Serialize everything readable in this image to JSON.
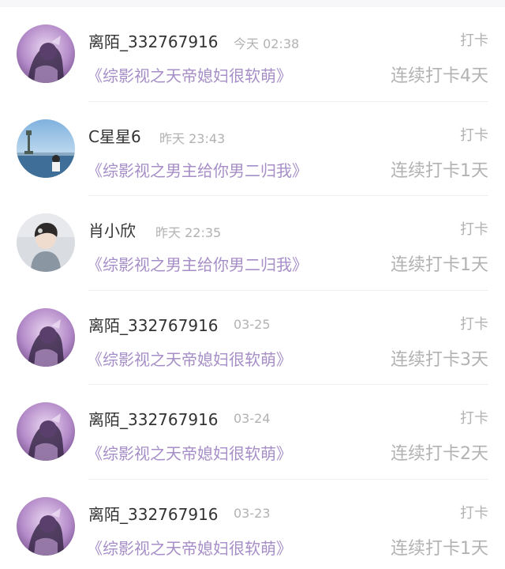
{
  "feed": {
    "items": [
      {
        "user": "离陌_332767916",
        "time": "今天 02:38",
        "book": "《综影视之天帝媳妇很软萌》",
        "tag": "打卡",
        "streak": "连续打卡4天",
        "avatar_icon": "purple-girl-avatar-icon"
      },
      {
        "user": "C星星6",
        "time": "昨天 23:43",
        "book": "《综影视之男主给你男二归我》",
        "tag": "打卡",
        "streak": "连续打卡1天",
        "avatar_icon": "statue-of-liberty-avatar-icon"
      },
      {
        "user": "肖小欣",
        "time": "昨天 22:35",
        "book": "《综影视之男主给你男二归我》",
        "tag": "打卡",
        "streak": "连续打卡1天",
        "avatar_icon": "boy-portrait-avatar-icon"
      },
      {
        "user": "离陌_332767916",
        "time": "03-25",
        "book": "《综影视之天帝媳妇很软萌》",
        "tag": "打卡",
        "streak": "连续打卡3天",
        "avatar_icon": "purple-girl-avatar-icon"
      },
      {
        "user": "离陌_332767916",
        "time": "03-24",
        "book": "《综影视之天帝媳妇很软萌》",
        "tag": "打卡",
        "streak": "连续打卡2天",
        "avatar_icon": "purple-girl-avatar-icon"
      },
      {
        "user": "离陌_332767916",
        "time": "03-23",
        "book": "《综影视之天帝媳妇很软萌》",
        "tag": "打卡",
        "streak": "连续打卡1天",
        "avatar_icon": "purple-girl-avatar-icon"
      }
    ]
  },
  "colors": {
    "book_title": "#a68ec7",
    "username": "#333333",
    "meta_gray": "#b2b2b2",
    "divider": "#efefef"
  }
}
